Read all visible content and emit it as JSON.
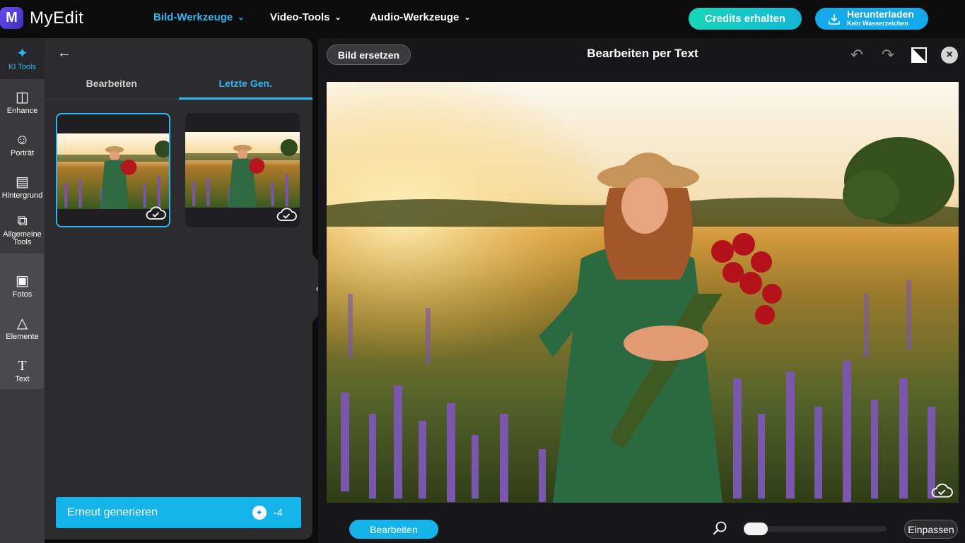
{
  "app": {
    "name": "MyEdit",
    "logo_letter": "M"
  },
  "nav": [
    {
      "label": "Bild-Werkzeuge",
      "active": true
    },
    {
      "label": "Video-Tools",
      "active": false
    },
    {
      "label": "Audio-Werkzeuge",
      "active": false
    }
  ],
  "header_buttons": {
    "credits": "Credits erhalten",
    "download_main": "Herunterladen",
    "download_sub": "Kein Wasserzeichen"
  },
  "rail": [
    {
      "label": "KI Tools",
      "icon": "magic-wand-icon",
      "active": true
    },
    {
      "label": "Enhance",
      "icon": "image-enhance-icon"
    },
    {
      "label": "Porträt",
      "icon": "portrait-icon"
    },
    {
      "label": "Hintergrund",
      "icon": "background-icon"
    },
    {
      "label": "Allgemeine Tools",
      "icon": "layers-icon"
    },
    {
      "label": "Fotos",
      "icon": "photo-icon"
    },
    {
      "label": "Elemente",
      "icon": "shapes-icon"
    },
    {
      "label": "Text",
      "icon": "text-icon"
    }
  ],
  "panel": {
    "tabs": [
      {
        "label": "Bearbeiten",
        "active": false
      },
      {
        "label": "Letzte Gen.",
        "active": true
      }
    ],
    "regen_label": "Erneut generieren",
    "regen_cost": "-4"
  },
  "workspace": {
    "replace_label": "Bild ersetzen",
    "title": "Bearbeiten per Text",
    "edit_label": "Bearbeiten",
    "fit_label": "Einpassen",
    "zoom_level": 0
  },
  "colors": {
    "accent": "#14b4ea",
    "active_text": "#2fb7f5",
    "credits_gradient_start": "#19d6b8"
  }
}
